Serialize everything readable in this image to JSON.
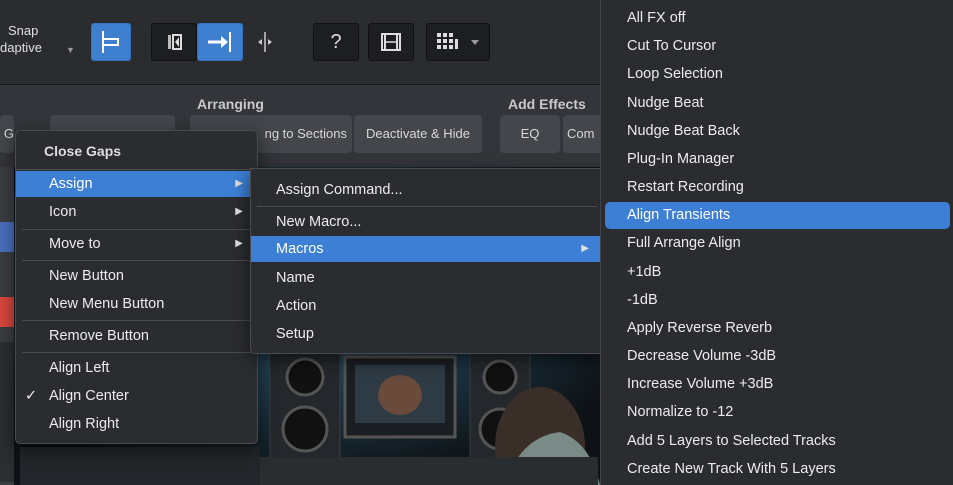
{
  "toolbar": {
    "snap_label": "Snap",
    "snap_value": "daptive",
    "help_label": "?"
  },
  "ribbon": {
    "section_arranging": "Arranging",
    "section_add_effects": "Add Effects",
    "btn_left": "G",
    "btn_sections": "ng to Sections",
    "btn_deactivate": "Deactivate & Hide",
    "btn_eq": "EQ",
    "btn_com": "Com"
  },
  "context_menu": {
    "header": "Close Gaps",
    "items": [
      {
        "label": "Assign",
        "submenu": true,
        "highlighted": true
      },
      {
        "label": "Icon",
        "submenu": true
      },
      {
        "label": "Move to",
        "submenu": true
      },
      {
        "label": "New Button"
      },
      {
        "label": "New Menu Button"
      },
      {
        "label": "Remove Button"
      },
      {
        "label": "Align Left"
      },
      {
        "label": "Align Center",
        "checked": true,
        "check": "✓"
      },
      {
        "label": "Align Right"
      }
    ]
  },
  "assign_menu": {
    "items": [
      {
        "label": "Assign Command..."
      },
      {
        "label": "New Macro..."
      },
      {
        "label": "Macros",
        "submenu": true,
        "highlighted": true
      },
      {
        "label": "Name"
      },
      {
        "label": "Action"
      },
      {
        "label": "Setup"
      }
    ]
  },
  "macros_menu": {
    "items": [
      {
        "label": "All FX off"
      },
      {
        "label": "Cut To Cursor"
      },
      {
        "label": "Loop Selection"
      },
      {
        "label": "Nudge Beat"
      },
      {
        "label": "Nudge Beat Back"
      },
      {
        "label": "Plug-In Manager"
      },
      {
        "label": "Restart Recording"
      },
      {
        "label": "Align Transients",
        "highlighted": true
      },
      {
        "label": "Full Arrange Align"
      },
      {
        "label": "+1dB"
      },
      {
        "label": "-1dB"
      },
      {
        "label": "Apply Reverse Reverb"
      },
      {
        "label": "Decrease Volume -3dB"
      },
      {
        "label": "Increase Volume +3dB"
      },
      {
        "label": "Normalize to -12"
      },
      {
        "label": "Add 5 Layers to Selected Tracks"
      },
      {
        "label": "Create New Track With 5 Layers"
      }
    ]
  },
  "colors": {
    "accent": "#3c7fd4",
    "menu_bg": "#2b2c30",
    "toolbar_bg": "#2a2c30"
  }
}
